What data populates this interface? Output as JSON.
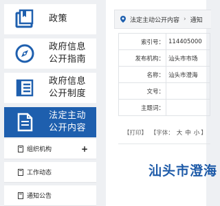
{
  "sidebar": {
    "nav": [
      {
        "label": "政策",
        "icon": "book-icon"
      },
      {
        "label": "政府信息\n公开指南",
        "icon": "compass-icon"
      },
      {
        "label": "政府信息\n公开制度",
        "icon": "list-document-icon"
      },
      {
        "label": "法定主动\n公开内容",
        "icon": "document-icon"
      }
    ],
    "sub": [
      {
        "label": "组织机构",
        "has_plus": "+"
      },
      {
        "label": "工作动态"
      },
      {
        "label": "通知公告"
      }
    ]
  },
  "breadcrumb": {
    "item1": "法定主动公开内容",
    "separator": "›",
    "item2": "通知"
  },
  "info_table": [
    {
      "key": "索引号：",
      "value": "114405000"
    },
    {
      "key": "发布机构：",
      "value": "汕头市市场"
    },
    {
      "key": "名称：",
      "value": "汕头市澄海"
    },
    {
      "key": "文号：",
      "value": ""
    },
    {
      "key": "主题词：",
      "value": ""
    }
  ],
  "tools": {
    "print": "【打印】",
    "font_label": "【字体：",
    "large": "大",
    "medium": "中",
    "small": "小",
    "close": "】"
  },
  "document": {
    "title": "汕头市澄海"
  },
  "colors": {
    "accent": "#1e5fae",
    "title_blue": "#1d5aa8"
  }
}
